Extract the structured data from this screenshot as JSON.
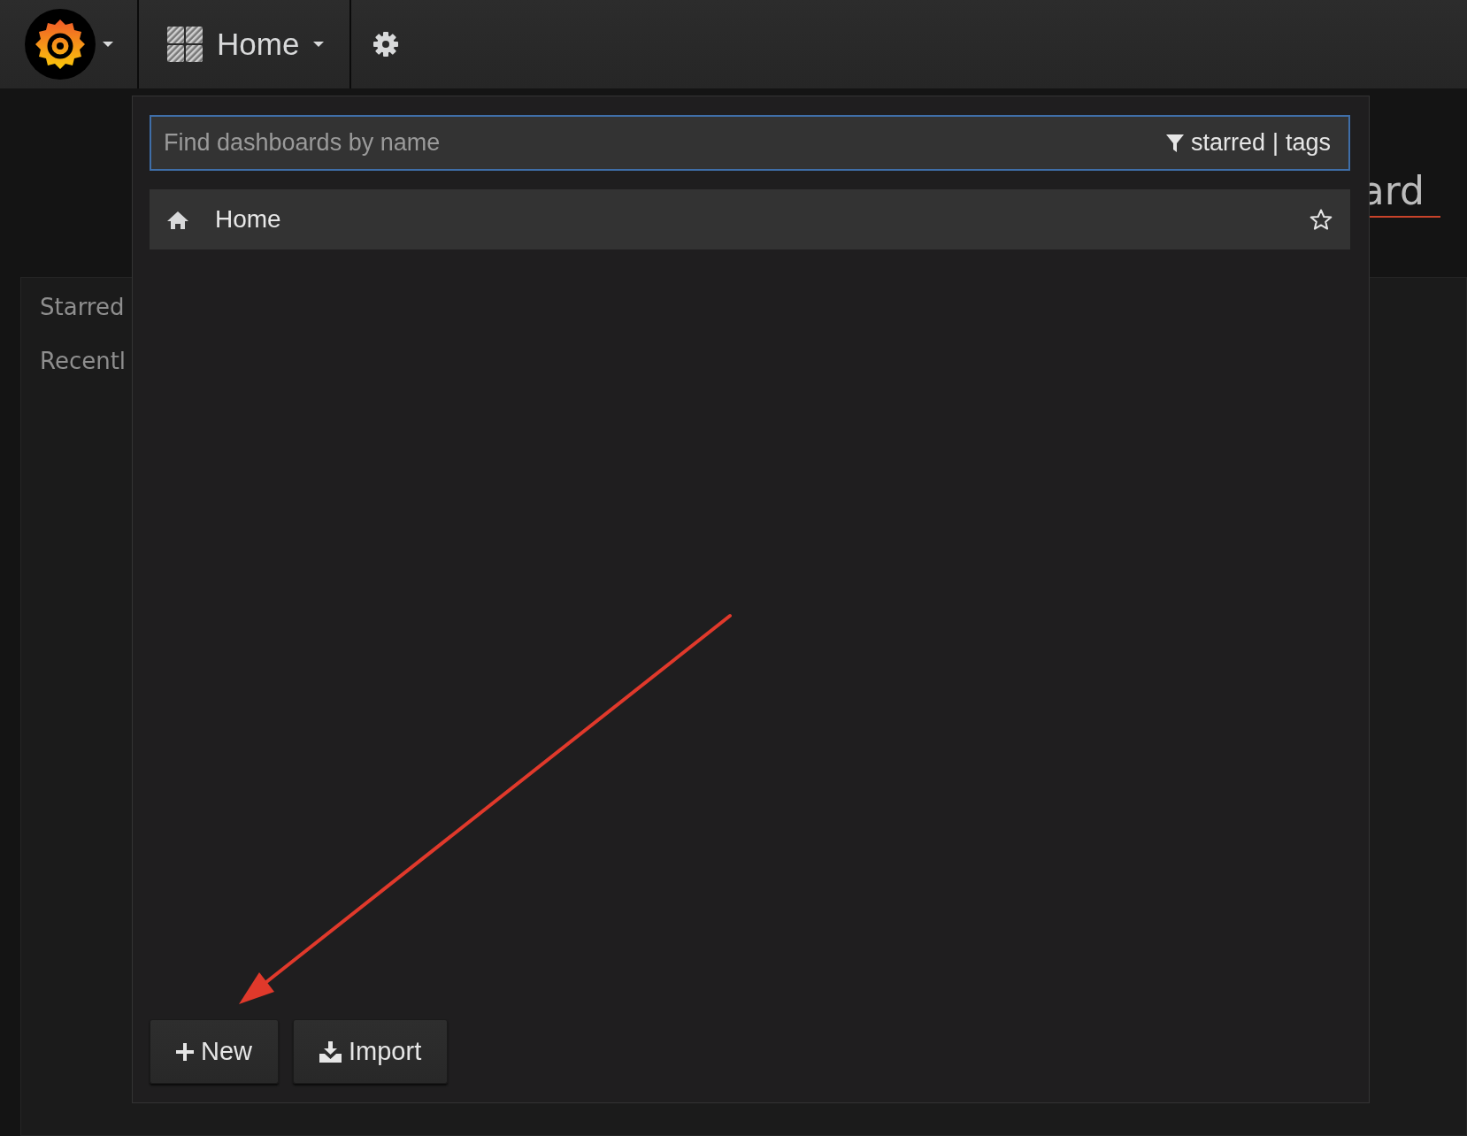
{
  "navbar": {
    "dashboard_title": "Home"
  },
  "background": {
    "title_fragment": "ard",
    "sidebar_items": [
      "Starred",
      "Recentl"
    ]
  },
  "search": {
    "placeholder": "Find dashboards by name",
    "filters": [
      "starred",
      "tags"
    ],
    "separator": "|"
  },
  "results": [
    {
      "title": "Home",
      "kind": "home",
      "starred": false
    }
  ],
  "buttons": [
    {
      "label": "New",
      "kind": "new"
    },
    {
      "label": "Import",
      "kind": "import"
    }
  ]
}
